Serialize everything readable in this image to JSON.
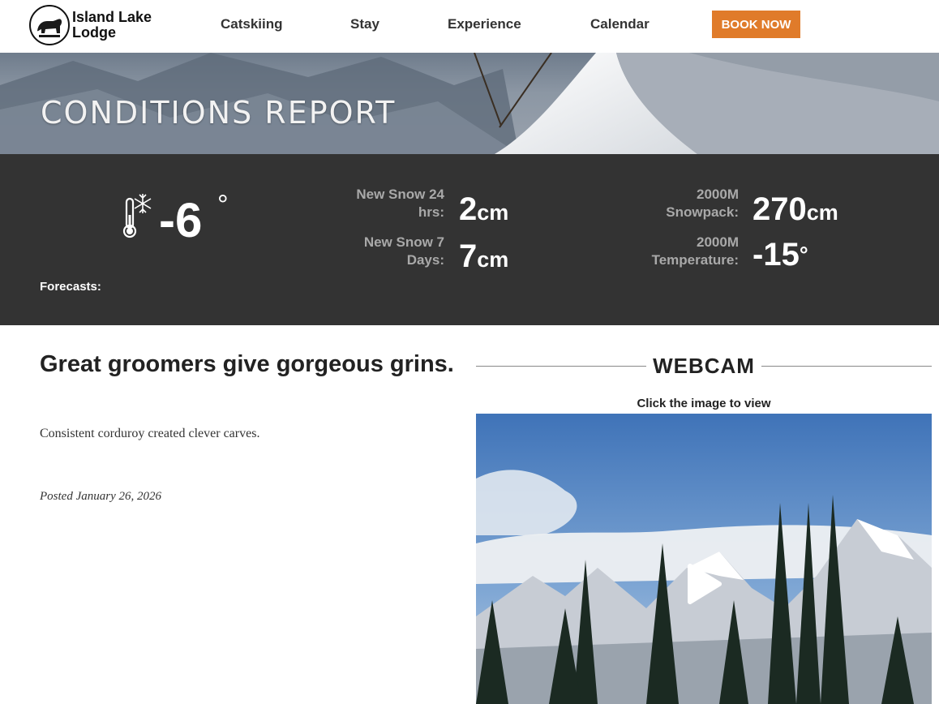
{
  "header": {
    "logo_name": "Island Lake Lodge",
    "nav": [
      "Catskiing",
      "Stay",
      "Experience",
      "Calendar"
    ],
    "cta": "BOOK NOW"
  },
  "hero": {
    "title": "CONDITIONS REPORT"
  },
  "conditions": {
    "temperature": "-6",
    "degree": "°",
    "new_snow_24": {
      "label": "New Snow 24 hrs:",
      "value": "2",
      "unit": "cm"
    },
    "new_snow_7": {
      "label": "New Snow 7 Days:",
      "value": "7",
      "unit": "cm"
    },
    "snowpack": {
      "label": "2000M Snowpack:",
      "value": "270",
      "unit": "cm"
    },
    "alpine_temp": {
      "label": "2000M Temperature:",
      "value": "-15",
      "unit": "°"
    },
    "forecasts_label": "Forecasts:"
  },
  "post": {
    "title": "Great groomers give gorgeous grins.",
    "body": "Consistent corduroy created clever carves.",
    "date": "Posted January 26, 2026"
  },
  "webcam": {
    "title": "WEBCAM",
    "caption": "Click the image to view"
  },
  "colors": {
    "accent": "#e07b2a",
    "band": "#333333",
    "label_gray": "#a9a9a9"
  }
}
